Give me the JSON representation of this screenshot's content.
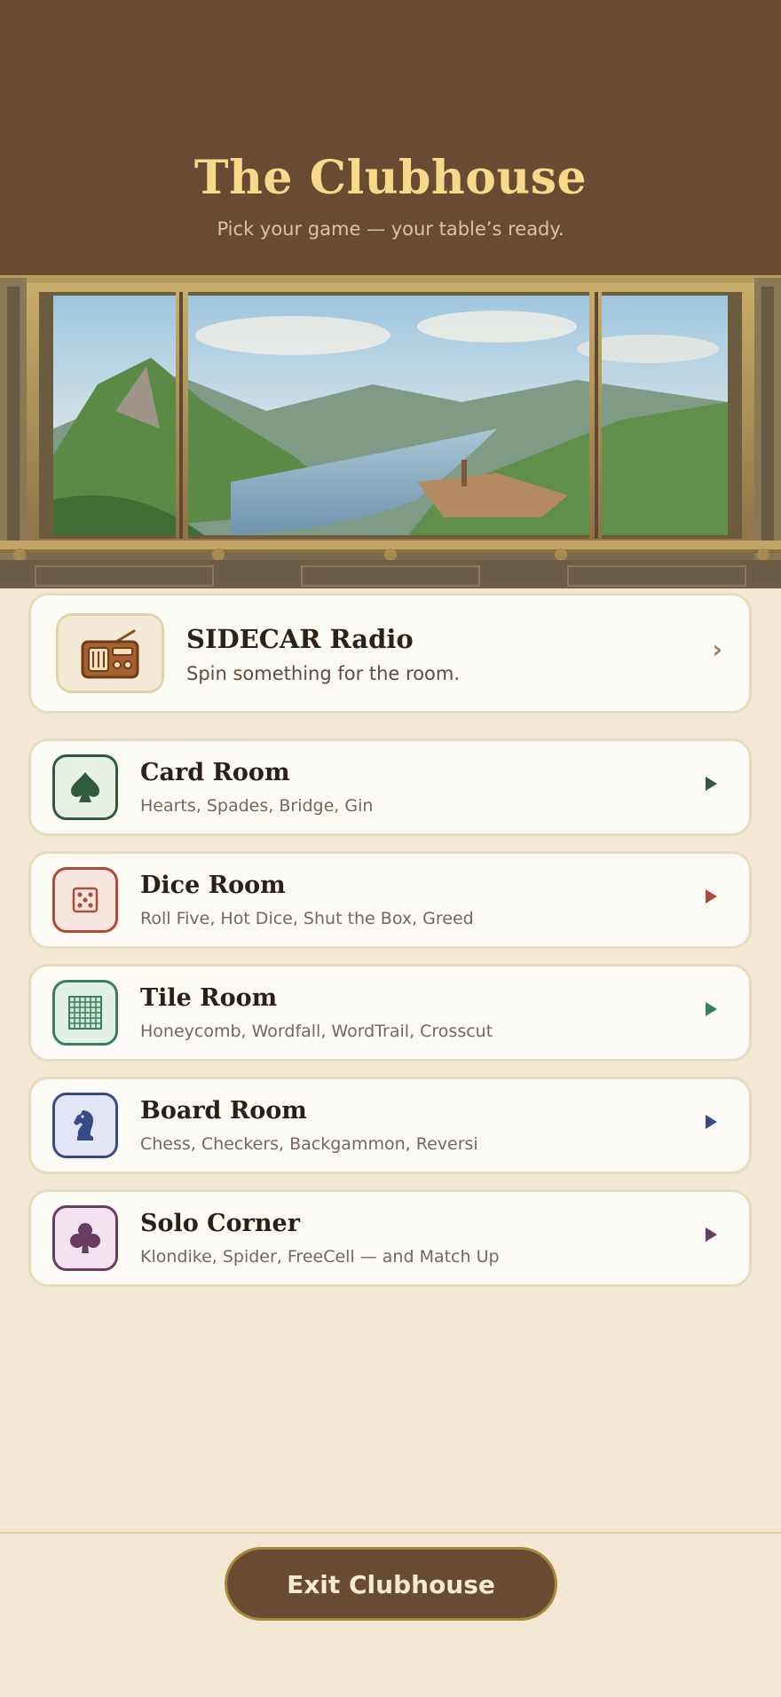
{
  "header": {
    "title": "The Clubhouse",
    "subtitle": "Pick your game — your table’s ready."
  },
  "radio": {
    "title": "SIDECAR Radio",
    "subtitle": "Spin something for the room.",
    "chevron": "›",
    "icon": "radio-icon"
  },
  "rooms": [
    {
      "title": "Card Room",
      "games": "Hearts, Spades, Bridge, Gin",
      "icon": "spade-icon",
      "accent": "#2f5a3c",
      "bg": "#e6f0e4"
    },
    {
      "title": "Dice Room",
      "games": "Roll Five, Hot Dice, Shut the Box, Greed",
      "icon": "dice-icon",
      "accent": "#b24a38",
      "bg": "#f7e6df"
    },
    {
      "title": "Tile Room",
      "games": "Honeycomb, Wordfall, WordTrail, Crosscut",
      "icon": "grid-tile-icon",
      "accent": "#3b7d5f",
      "bg": "#e2f0e8"
    },
    {
      "title": "Board Room",
      "games": "Chess, Checkers, Backgammon, Reversi",
      "icon": "knight-icon",
      "accent": "#394b87",
      "bg": "#e3e7f5"
    },
    {
      "title": "Solo Corner",
      "games": "Klondike, Spider, FreeCell — and Match Up",
      "icon": "club-icon",
      "accent": "#6a3c62",
      "bg": "#f3e3ee"
    }
  ],
  "footer": {
    "exit_label": "Exit Clubhouse"
  },
  "colors": {
    "header_bg": "#694b33",
    "title": "#f7d98a",
    "page_bg": "#f3e8d4",
    "button_border": "#a88736"
  }
}
